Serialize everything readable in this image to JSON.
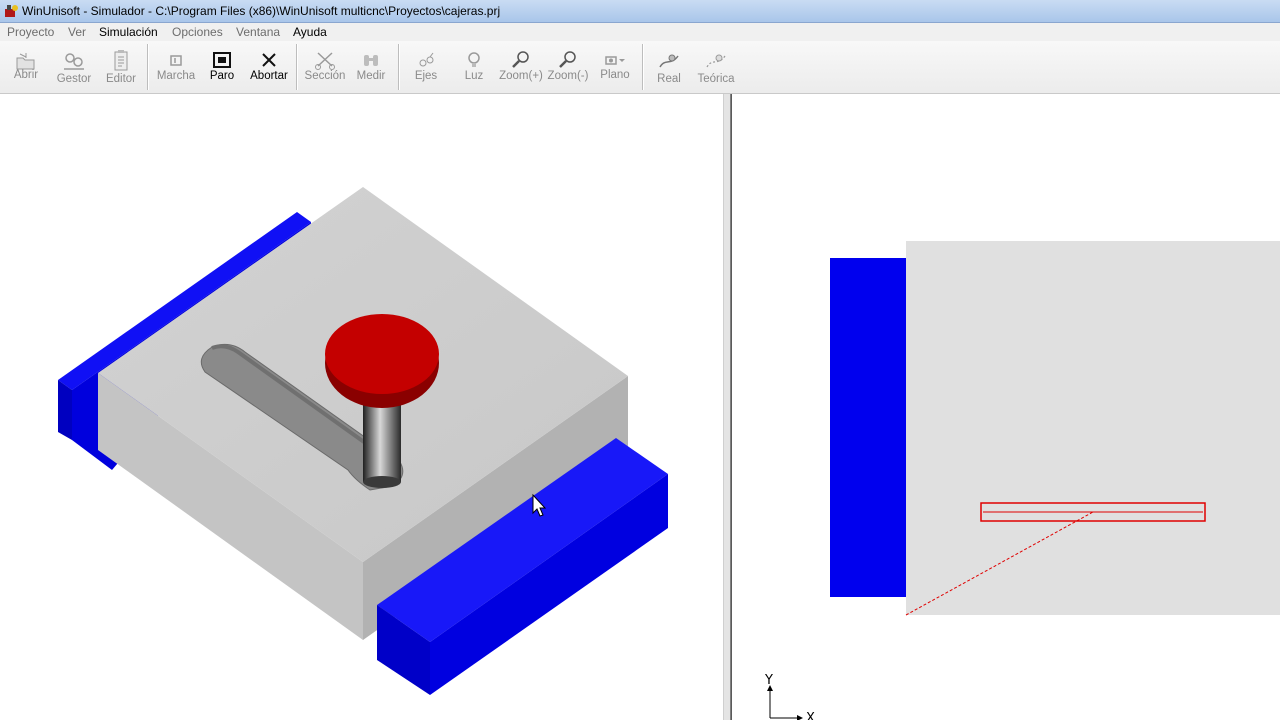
{
  "window": {
    "title": "WinUnisoft - Simulador - C:\\Program Files (x86)\\WinUnisoft multicnc\\Proyectos\\cajeras.prj"
  },
  "menu": [
    {
      "label": "Proyecto",
      "enabled": false
    },
    {
      "label": "Ver",
      "enabled": false
    },
    {
      "label": "Simulación",
      "enabled": true
    },
    {
      "label": "Opciones",
      "enabled": false
    },
    {
      "label": "Ventana",
      "enabled": false
    },
    {
      "label": "Ayuda",
      "enabled": true
    }
  ],
  "toolbar": {
    "abrir": "Abrir",
    "gestor": "Gestor",
    "editor": "Editor",
    "marcha": "Marcha",
    "paro": "Paro",
    "abortar": "Abortar",
    "seccion": "Sección",
    "medir": "Medir",
    "ejes": "Ejes",
    "luz": "Luz",
    "zoom_in": "Zoom(+)",
    "zoom_out": "Zoom(-)",
    "plano": "Plano",
    "real": "Real",
    "teorica": "Teórica"
  },
  "plan_view": {
    "axis_y": "Y",
    "axis_x": "X"
  },
  "colors": {
    "clamp": "#0000ee",
    "stock": "#d6d6d6",
    "tool_holder": "#c40000",
    "toolpath": "#e00000"
  }
}
